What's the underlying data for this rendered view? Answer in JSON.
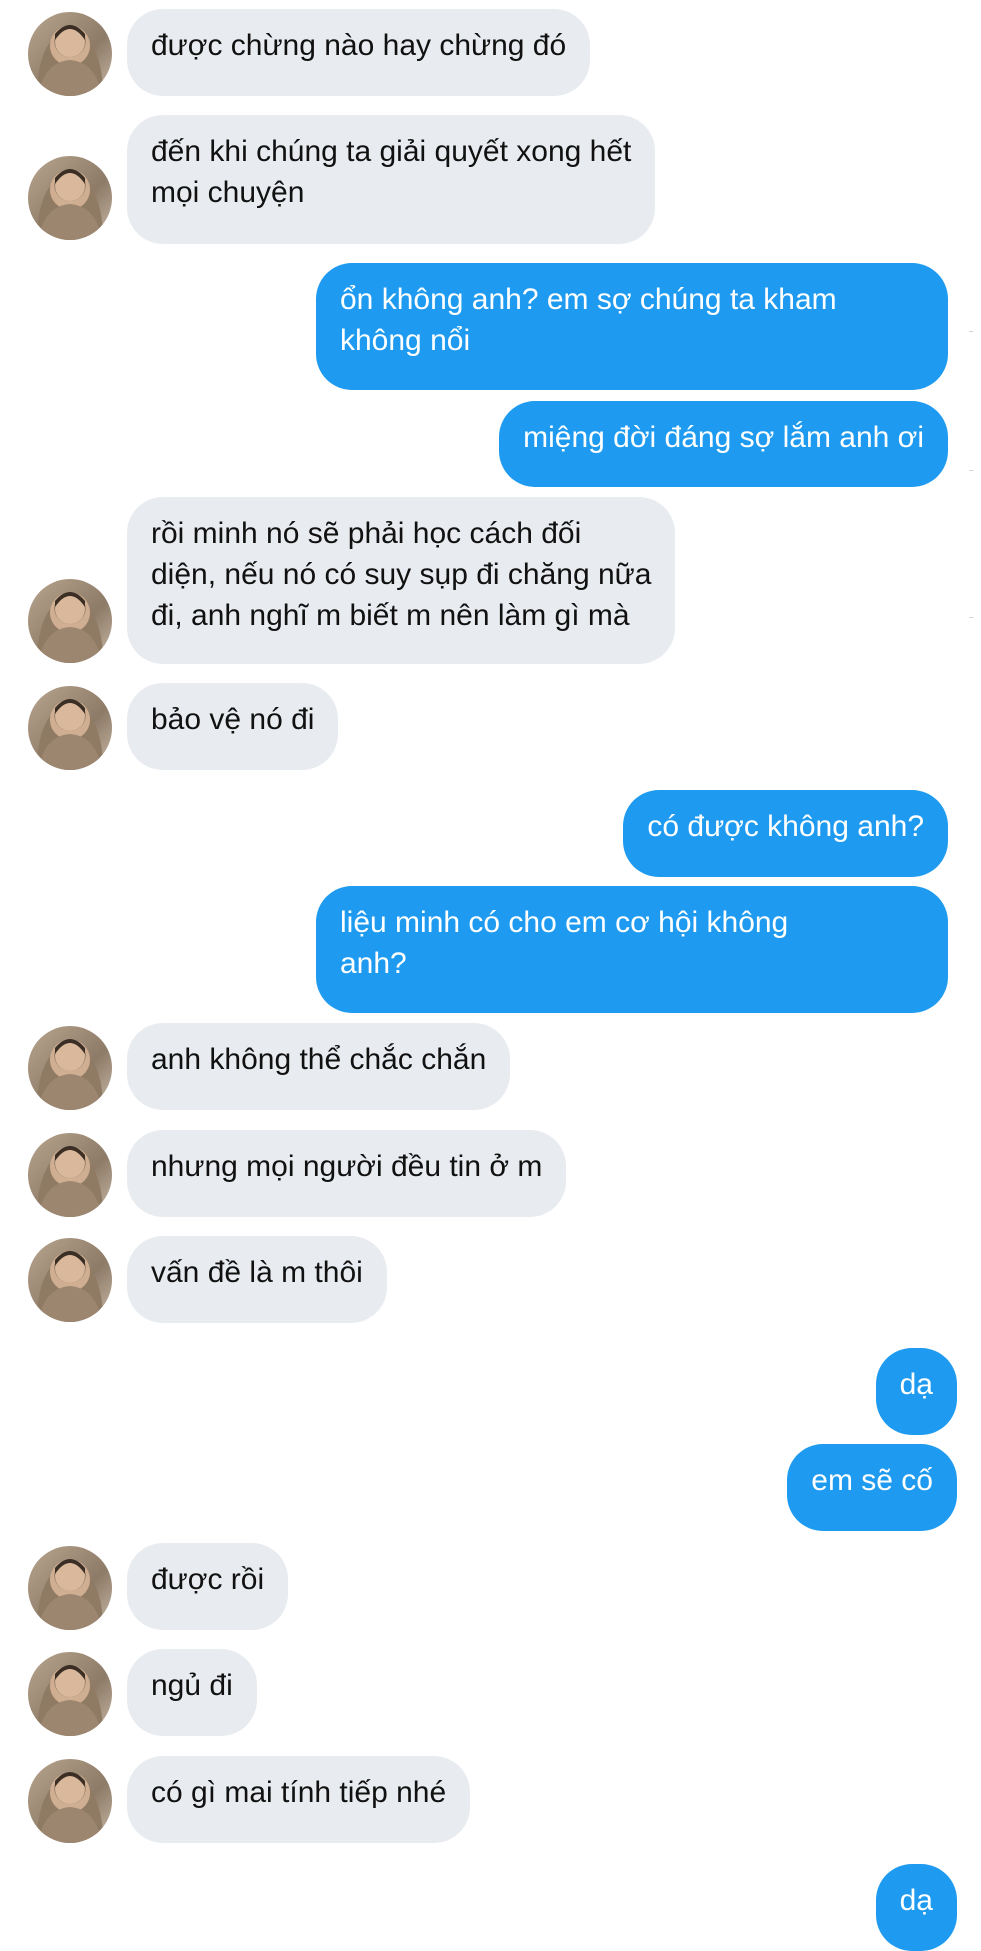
{
  "colors": {
    "incoming_bg": "#e8ebef",
    "outgoing_bg": "#1e9bf0",
    "incoming_text": "#111111",
    "outgoing_text": "#ffffff"
  },
  "messages": [
    {
      "sender": "them",
      "text": "được chừng nào hay chừng đó",
      "avatar_icon": "profile-photo"
    },
    {
      "sender": "them",
      "text": "đến khi chúng ta giải quyết xong hết\nmọi chuyện",
      "avatar_icon": "profile-photo"
    },
    {
      "sender": "me",
      "text": "ổn không anh? em sợ chúng ta kham\nkhông nổi"
    },
    {
      "sender": "me",
      "text": "miệng đời đáng sợ lắm anh ơi"
    },
    {
      "sender": "them",
      "text": "rồi minh nó sẽ phải học cách đối\ndiện, nếu nó có suy sụp đi chăng nữa\nđi, anh nghĩ m biết m nên làm gì mà",
      "avatar_icon": "profile-photo"
    },
    {
      "sender": "them",
      "text": "bảo vệ nó đi",
      "avatar_icon": "profile-photo"
    },
    {
      "sender": "me",
      "text": "có được không anh?"
    },
    {
      "sender": "me",
      "text": "liệu minh có cho em cơ hội không\nanh?"
    },
    {
      "sender": "them",
      "text": "anh không thể chắc chắn",
      "avatar_icon": "profile-photo"
    },
    {
      "sender": "them",
      "text": "nhưng mọi người đều tin ở m",
      "avatar_icon": "profile-photo"
    },
    {
      "sender": "them",
      "text": "vấn đề là m thôi",
      "avatar_icon": "profile-photo"
    },
    {
      "sender": "me",
      "text": "dạ"
    },
    {
      "sender": "me",
      "text": "em sẽ cố"
    },
    {
      "sender": "them",
      "text": "được rồi",
      "avatar_icon": "profile-photo"
    },
    {
      "sender": "them",
      "text": "ngủ đi",
      "avatar_icon": "profile-photo"
    },
    {
      "sender": "them",
      "text": "có gì mai tính tiếp nhé",
      "avatar_icon": "profile-photo"
    },
    {
      "sender": "me",
      "text": "dạ"
    }
  ]
}
